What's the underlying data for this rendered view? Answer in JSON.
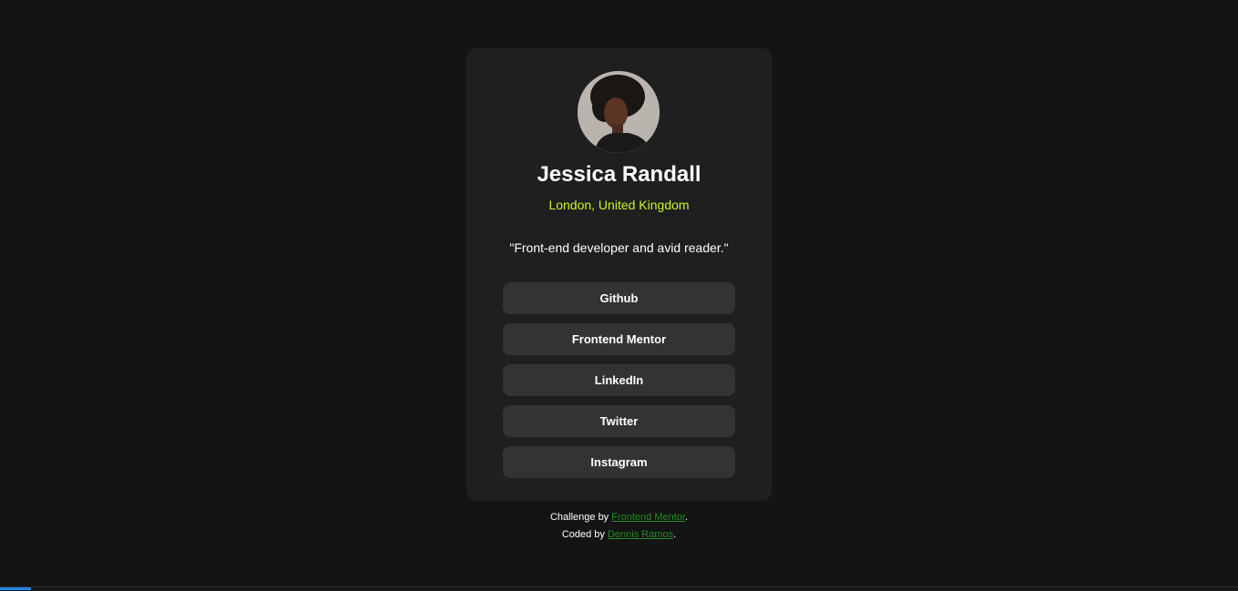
{
  "profile": {
    "name": "Jessica Randall",
    "location": "London, United Kingdom",
    "bio": "\"Front-end developer and avid reader.\""
  },
  "links": [
    {
      "label": "Github"
    },
    {
      "label": "Frontend Mentor"
    },
    {
      "label": "LinkedIn"
    },
    {
      "label": "Twitter"
    },
    {
      "label": "Instagram"
    }
  ],
  "attribution": {
    "challenge_prefix": "Challenge by ",
    "challenge_link": "Frontend Mentor",
    "coded_prefix": "Coded by ",
    "coded_link": "Dennis Ramos",
    "suffix": "."
  },
  "colors": {
    "background": "#141414",
    "card": "#1f1f1f",
    "button": "#333333",
    "accent": "#c4f82a",
    "attribution_link": "#228b22"
  }
}
